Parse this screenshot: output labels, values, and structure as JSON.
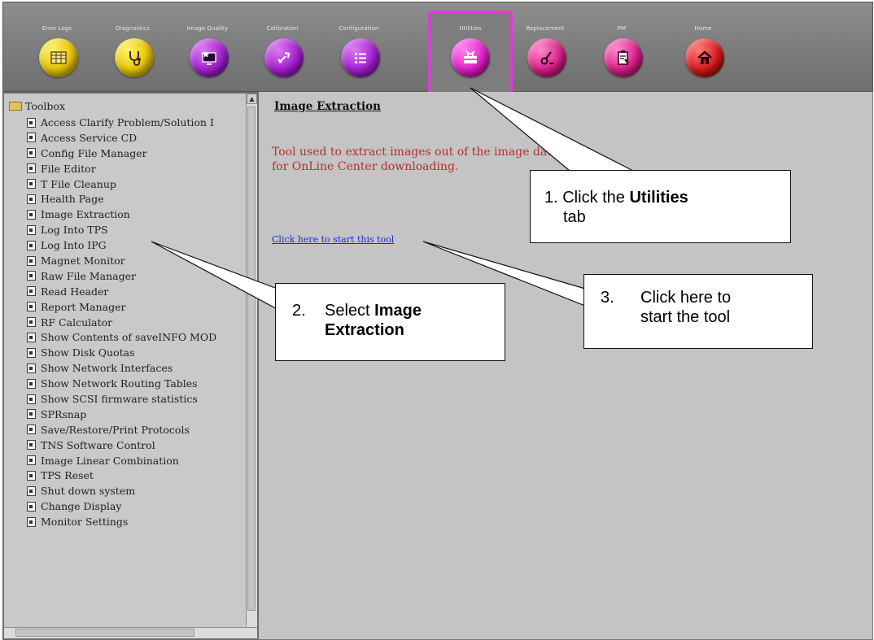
{
  "tabs": [
    {
      "label": "Error Logs",
      "icon": "table-icon",
      "color": "yellow"
    },
    {
      "label": "Diagnostics",
      "icon": "stethoscope-icon",
      "color": "yellow"
    },
    {
      "label": "Image Quality",
      "icon": "monitor-star-icon",
      "color": "purple"
    },
    {
      "label": "Calibration",
      "icon": "wrench-icon",
      "color": "purple"
    },
    {
      "label": "Configuration",
      "icon": "checklist-icon",
      "color": "purple"
    },
    {
      "label": "Utilities",
      "icon": "toolbox-icon",
      "color": "magenta",
      "active": true
    },
    {
      "label": "Replacement",
      "icon": "tool-swap-icon",
      "color": "pink"
    },
    {
      "label": "PM",
      "icon": "clipboard-icon",
      "color": "pink"
    },
    {
      "label": "Home",
      "icon": "home-icon",
      "color": "red"
    }
  ],
  "sidebar": {
    "root_label": "Toolbox",
    "items": [
      "Access Clarify Problem/Solution I",
      "Access Service CD",
      "Config File Manager",
      "File Editor",
      "T File Cleanup",
      "Health Page",
      "Image Extraction",
      "Log Into TPS",
      "Log Into IPG",
      "Magnet Monitor",
      "Raw File Manager",
      "Read Header",
      "Report Manager",
      "RF Calculator",
      "Show Contents of saveINFO MOD",
      "Show Disk Quotas",
      "Show Network Interfaces",
      "Show Network Routing Tables",
      "Show SCSI firmware statistics",
      "SPRsnap",
      "Save/Restore/Print Protocols",
      "TNS Software Control",
      "Image Linear Combination",
      "TPS Reset",
      "Shut down system",
      "Change Display",
      "Monitor Settings"
    ]
  },
  "main": {
    "title": "Image Extraction",
    "description": "Tool used to extract images out of the image database\nfor OnLine Center downloading.",
    "start_link": "Click here to start this tool"
  },
  "callouts": {
    "step1": {
      "prefix": "1. Click the ",
      "bold": "Utilities",
      "suffix": "tab"
    },
    "step2": {
      "prefix": "2.",
      "line1_text": "Select ",
      "bold1": "Image",
      "bold2": "Extraction"
    },
    "step3": {
      "prefix": "3.",
      "line1": "Click here to",
      "line2": "start the tool"
    }
  },
  "colors": {
    "description_text": "#b3302c",
    "link": "#1c2bd6",
    "active_tab_border": "#e33ad6"
  }
}
